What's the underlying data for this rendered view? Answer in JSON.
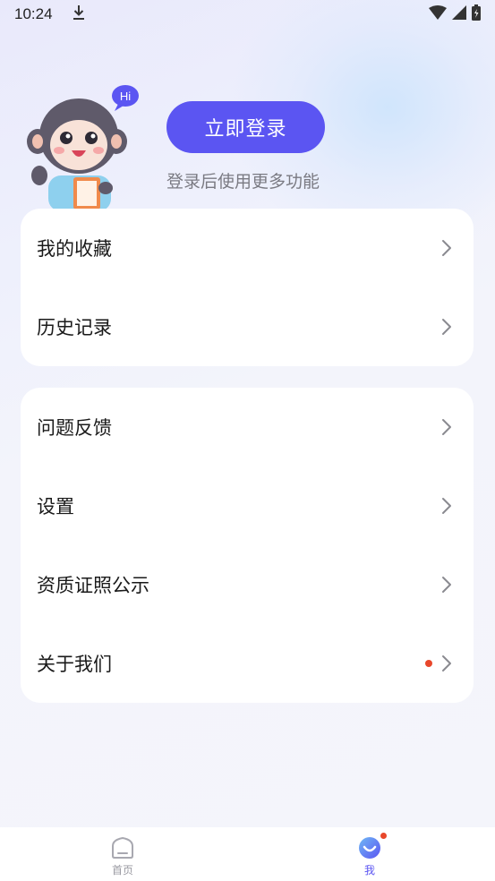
{
  "status_bar": {
    "time": "10:24",
    "download_icon": "download-icon",
    "wifi_icon": "wifi-icon",
    "signal_icon": "signal-icon",
    "battery_icon": "battery-icon"
  },
  "header": {
    "mascot_bubble": "Hi",
    "login_button": "立即登录",
    "login_hint": "登录后使用更多功能"
  },
  "menu_group_1": [
    {
      "label": "我的收藏",
      "icon": "chevron-right-icon"
    },
    {
      "label": "历史记录",
      "icon": "chevron-right-icon"
    }
  ],
  "menu_group_2": [
    {
      "label": "问题反馈",
      "icon": "chevron-right-icon"
    },
    {
      "label": "设置",
      "icon": "chevron-right-icon"
    },
    {
      "label": "资质证照公示",
      "icon": "chevron-right-icon"
    },
    {
      "label": "关于我们",
      "icon": "chevron-right-icon",
      "has_red_dot": true
    }
  ],
  "bottom_nav": {
    "home_label": "首页",
    "me_label": "我",
    "active": "我"
  },
  "colors": {
    "accent": "#5b55f2",
    "badge": "#e8472b",
    "background": "#f4f4fb"
  }
}
